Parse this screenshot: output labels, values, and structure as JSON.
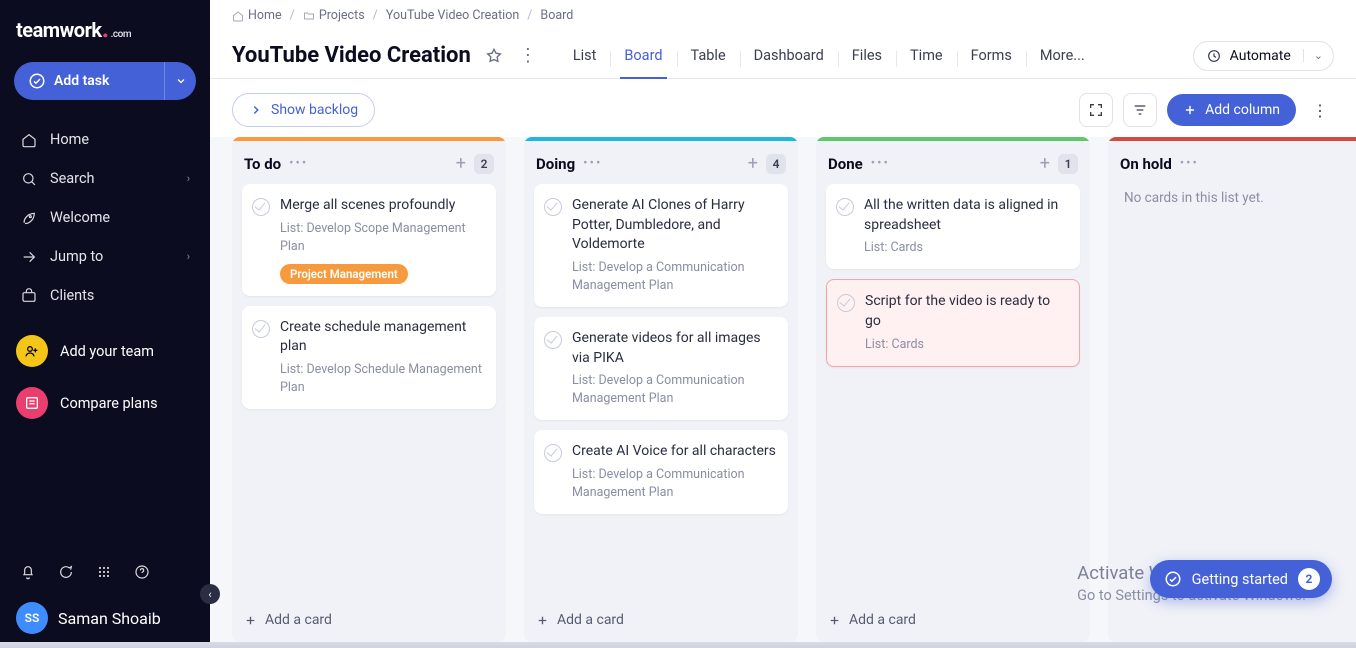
{
  "brand": {
    "name": "teamwork",
    "tld": ".com"
  },
  "sidebar": {
    "add_task": "Add task",
    "nav": [
      {
        "label": "Home"
      },
      {
        "label": "Search",
        "chev": true
      },
      {
        "label": "Welcome"
      },
      {
        "label": "Jump to",
        "chev": true
      },
      {
        "label": "Clients"
      }
    ],
    "add_team": "Add your team",
    "compare": "Compare plans",
    "user": {
      "initials": "SS",
      "name": "Saman Shoaib"
    }
  },
  "breadcrumbs": [
    "Home",
    "Projects",
    "YouTube Video Creation",
    "Board"
  ],
  "header": {
    "title": "YouTube Video Creation",
    "tabs": [
      "List",
      "Board",
      "Table",
      "Dashboard",
      "Files",
      "Time",
      "Forms",
      "More..."
    ],
    "active_tab": 1,
    "automate": "Automate"
  },
  "board_tools": {
    "show_backlog": "Show backlog",
    "add_column": "Add column"
  },
  "columns": [
    {
      "name": "To do",
      "count": "2",
      "color": "orange",
      "empty": "",
      "cards": [
        {
          "title": "Merge all scenes profoundly",
          "meta": "List: Develop Scope Management Plan",
          "tag": "Project Management"
        },
        {
          "title": "Create schedule management plan",
          "meta": "List: Develop Schedule Management Plan"
        }
      ]
    },
    {
      "name": "Doing",
      "count": "4",
      "color": "cyan",
      "empty": "",
      "cards": [
        {
          "title": "Generate AI Clones of Harry Potter, Dumbledore, and Voldemorte",
          "meta": "List: Develop a Communication Management Plan"
        },
        {
          "title": "Generate videos for all images via PIKA",
          "meta": "List: Develop a Communication Management Plan"
        },
        {
          "title": "Create AI Voice for all characters",
          "meta": "List: Develop a Communication Management Plan"
        }
      ]
    },
    {
      "name": "Done",
      "count": "1",
      "color": "green",
      "empty": "",
      "cards": [
        {
          "title": "All the written data is aligned in spreadsheet",
          "meta": "List: Cards"
        },
        {
          "title": "Script for the video is ready to go",
          "meta": "List: Cards",
          "highlight": true
        }
      ]
    },
    {
      "name": "On hold",
      "count": "",
      "color": "red",
      "empty": "No cards in this list yet.",
      "cards": []
    }
  ],
  "add_card": "Add a card",
  "watermark": {
    "line1": "Activate Windows",
    "line2": "Go to Settings to activate Windows."
  },
  "getting_started": {
    "label": "Getting started",
    "count": "2"
  }
}
